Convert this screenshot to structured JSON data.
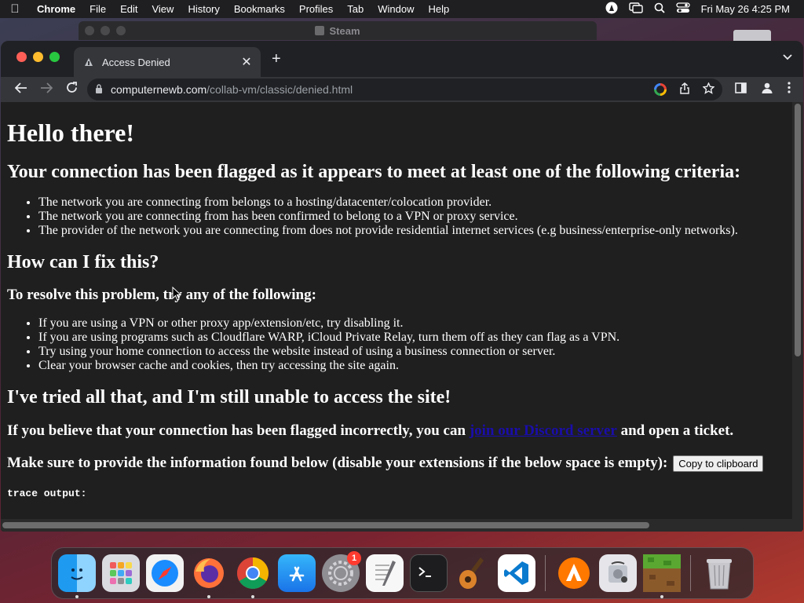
{
  "menubar": {
    "app": "Chrome",
    "items": [
      "File",
      "Edit",
      "View",
      "History",
      "Bookmarks",
      "Profiles",
      "Tab",
      "Window",
      "Help"
    ],
    "clock": "Fri May 26  4:25 PM"
  },
  "background_window": {
    "title": "Steam"
  },
  "browser": {
    "tab_title": "Access Denied",
    "url_host": "computernewb.com",
    "url_path": "/collab-vm/classic/denied.html"
  },
  "page": {
    "h1": "Hello there!",
    "h2_flagged": "Your connection has been flagged as it appears to meet at least one of the following criteria:",
    "criteria": [
      "The network you are connecting from belongs to a hosting/datacenter/colocation provider.",
      "The network you are connecting from has been confirmed to belong to a VPN or proxy service.",
      "The provider of the network you are connecting from does not provide residential internet services (e.g business/enterprise-only networks)."
    ],
    "h2_fix": "How can I fix this?",
    "h3_resolve": "To resolve this problem, try any of the following:",
    "fixes": [
      "If you are using a VPN or other proxy app/extension/etc, try disabling it.",
      "If you are using programs such as Cloudflare WARP, iCloud Private Relay, turn them off as they can flag as a VPN.",
      "Try using your home connection to access the website instead of using a business connection or server.",
      "Clear your browser cache and cookies, then try accessing the site again."
    ],
    "h2_tried": "I've tried all that, and I'm still unable to access the site!",
    "incorrect_before": "If you believe that your connection has been flagged incorrectly, you can ",
    "discord_link": "join our Discord server",
    "incorrect_after": " and open a ticket.",
    "provide_info": "Make sure to provide the information found below (disable your extensions if the below space is empty):",
    "copy_button": "Copy to clipboard",
    "trace_label": "trace output:"
  },
  "dock": {
    "items": [
      "Finder",
      "Launchpad",
      "Safari",
      "Firefox",
      "Chrome",
      "App Store",
      "System Preferences",
      "TextEdit",
      "Terminal",
      "GarageBand",
      "Visual Studio Code",
      "Avast",
      "Disk Utility",
      "Minecraft",
      "Trash"
    ],
    "system_preferences_badge": "1"
  },
  "colors": {
    "link": "#1a0dab",
    "page_bg": "#1f1f1f",
    "badge": "#ff3b30"
  }
}
